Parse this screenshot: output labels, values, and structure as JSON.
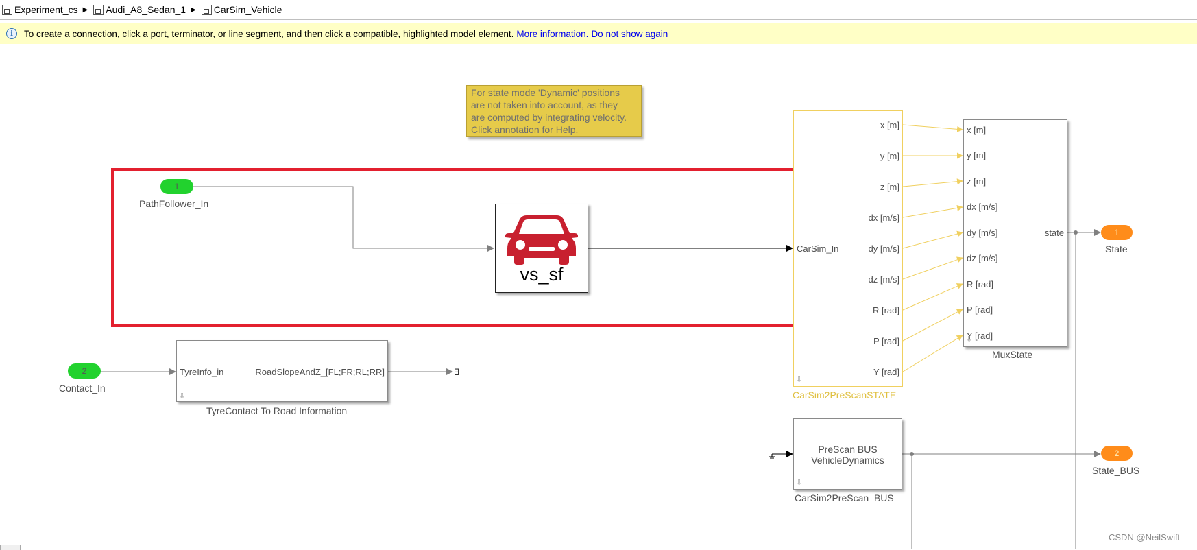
{
  "breadcrumb": [
    "Experiment_cs",
    "Audi_A8_Sedan_1",
    "CarSim_Vehicle"
  ],
  "infobar": {
    "message": "To create a connection, click a port, terminator, or line segment, and then click a compatible, highlighted model element.",
    "link_more": "More information.",
    "link_hide": "Do not show again"
  },
  "annotation": {
    "lines": [
      "For state mode 'Dynamic' positions",
      "are not taken into account, as they",
      "are computed by integrating velocity.",
      "Click annotation for Help."
    ]
  },
  "inports": {
    "path_follower": {
      "number": "1",
      "label": "PathFollower_In"
    },
    "contact": {
      "number": "2",
      "label": "Contact_In"
    }
  },
  "vs_block": {
    "label": "vs_sf",
    "icon": "car-icon",
    "icon_color": "#c8202f"
  },
  "tyre_block": {
    "in_port": "TyreInfo_in",
    "out_port": "RoadSlopeAndZ_[FL;FR;RL;RR]",
    "name": "TyreContact To Road Information"
  },
  "state_block": {
    "in_port": "CarSim_In",
    "outputs": [
      "x [m]",
      "y [m]",
      "z [m]",
      "dx [m/s]",
      "dy [m/s]",
      "dz [m/s]",
      "R [rad]",
      "P [rad]",
      "Y [rad]"
    ],
    "name": "CarSim2PreScanSTATE"
  },
  "mux_block": {
    "inputs": [
      "x [m]",
      "y [m]",
      "z [m]",
      "dx [m/s]",
      "dy [m/s]",
      "dz [m/s]",
      "R [rad]",
      "P [rad]",
      "Y [rad]"
    ],
    "output": "state",
    "name": "MuxState"
  },
  "bus_block": {
    "line1": "PreScan BUS",
    "line2": "VehicleDynamics",
    "name": "CarSim2PreScan_BUS"
  },
  "outports": {
    "state": {
      "number": "1",
      "label": "State"
    },
    "state_bus": {
      "number": "2",
      "label": "State_BUS"
    }
  },
  "watermark": "CSDN @NeilSwift",
  "colors": {
    "highlight_red": "#e3202f",
    "selected_yellow": "#f0d060",
    "inport_green": "#22d22e",
    "outport_orange": "#ff8c1a",
    "note_yellow": "#e6cb4a"
  }
}
